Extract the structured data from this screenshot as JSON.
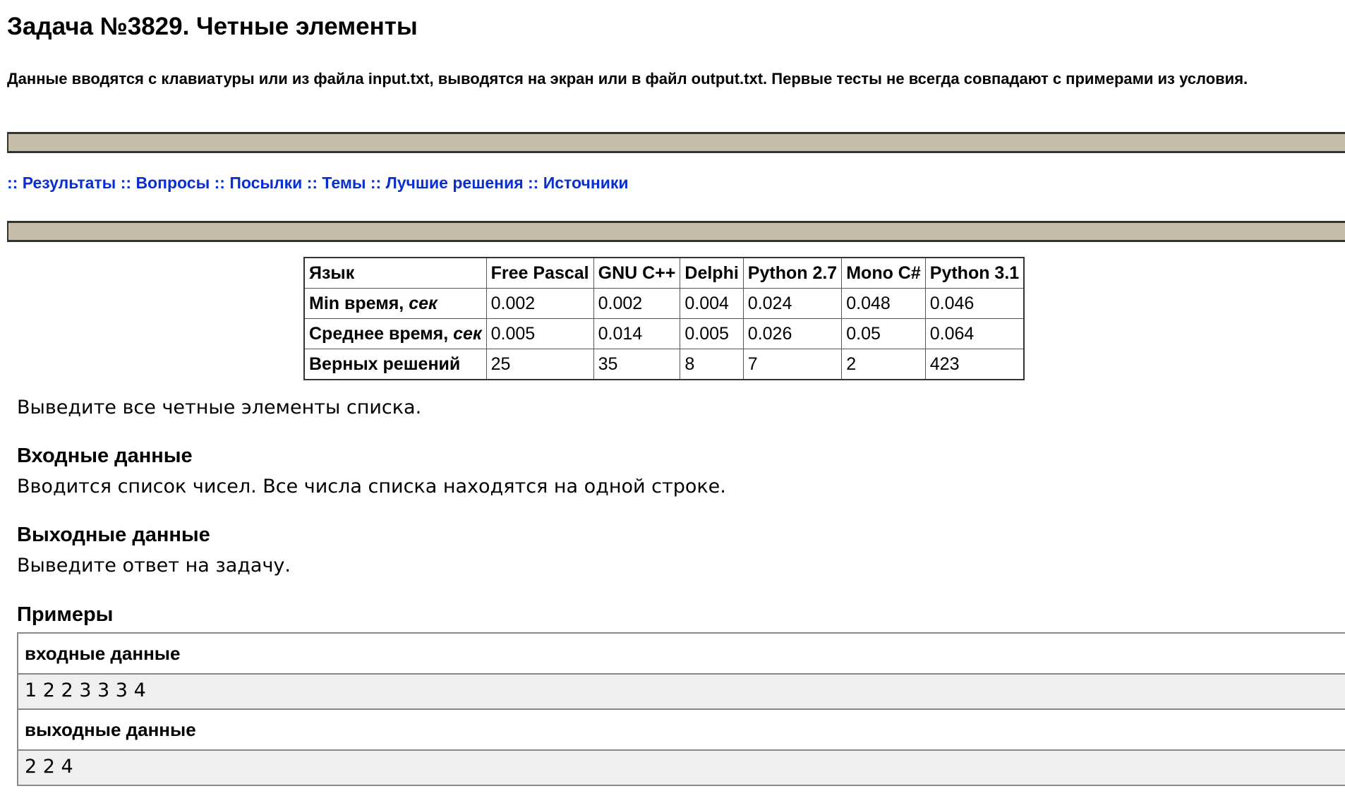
{
  "title": "Задача №3829. Четные элементы",
  "io_note": "Данные вводятся с клавиатуры или из файла input.txt, выводятся на экран или в файл output.txt. Первые тесты не всегда совпадают с примерами из условия.",
  "nav": {
    "separator": "::",
    "items": [
      "Результаты",
      "Вопросы",
      "Посылки",
      "Темы",
      "Лучшие решения",
      "Источники"
    ]
  },
  "stats": {
    "header": [
      "Язык",
      "Free Pascal",
      "GNU C++",
      "Delphi",
      "Python 2.7",
      "Mono C#",
      "Python 3.1"
    ],
    "rows": [
      {
        "label": "Min время, ",
        "unit": "сек",
        "values": [
          "0.002",
          "0.002",
          "0.004",
          "0.024",
          "0.048",
          "0.046"
        ]
      },
      {
        "label": "Среднее время, ",
        "unit": "сек",
        "values": [
          "0.005",
          "0.014",
          "0.005",
          "0.026",
          "0.05",
          "0.064"
        ]
      },
      {
        "label": "Верных решений",
        "unit": "",
        "values": [
          "25",
          "35",
          "8",
          "7",
          "2",
          "423"
        ]
      }
    ]
  },
  "statement": "Выведите все четные элементы списка.",
  "input_heading": "Входные данные",
  "input_text": "Вводится список чисел. Все числа списка находятся на одной строке.",
  "output_heading": "Выходные данные",
  "output_text": "Выведите ответ на задачу.",
  "examples_heading": "Примеры",
  "examples": {
    "input_label": "входные данные",
    "input_value": "1 2 2 3 3 3 4",
    "output_label": "выходные данные",
    "output_value": "2 2 4"
  },
  "colors": {
    "bar": "#c6bea8",
    "link": "#0a2fd0",
    "example_data_bg": "#efefef"
  }
}
